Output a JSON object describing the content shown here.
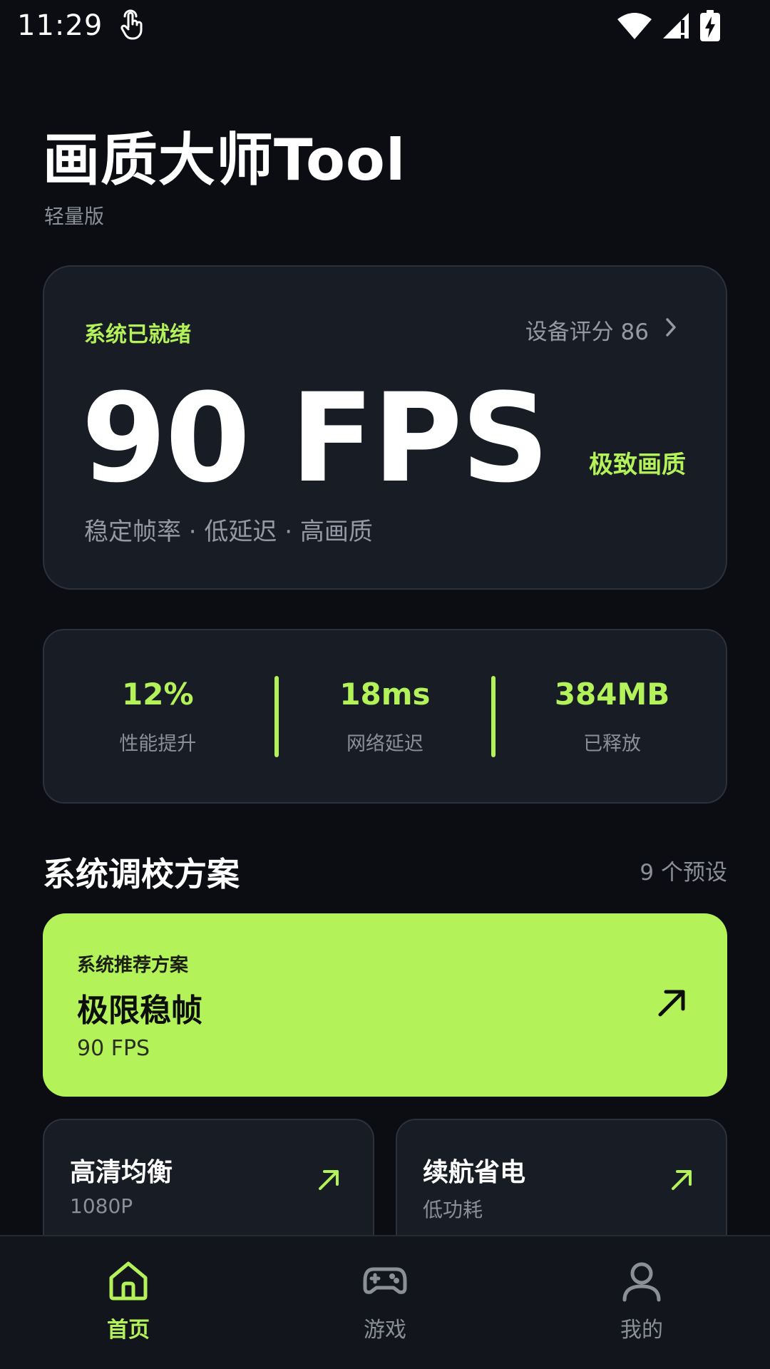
{
  "status_bar": {
    "time": "11:29",
    "icons": [
      "touch-icon",
      "wifi-icon",
      "signal-icon",
      "battery-charging-icon"
    ]
  },
  "header": {
    "title": "画质大师Tool",
    "subtitle": "轻量版"
  },
  "hero": {
    "status": "系统已就绪",
    "score_label": "设备评分 86",
    "fps": "90 FPS",
    "quality": "极致画质",
    "description": "稳定帧率 · 低延迟 · 高画质"
  },
  "stats": [
    {
      "value": "12%",
      "label": "性能提升"
    },
    {
      "value": "18ms",
      "label": "网络延迟"
    },
    {
      "value": "384MB",
      "label": "已释放"
    }
  ],
  "section": {
    "title": "系统调校方案",
    "count": "9 个预设"
  },
  "featured": {
    "tag": "系统推荐方案",
    "name": "极限稳帧",
    "value": "90 FPS"
  },
  "presets": [
    {
      "name": "高清均衡",
      "value": "1080P"
    },
    {
      "name": "续航省电",
      "value": "低功耗"
    }
  ],
  "nav": [
    {
      "label": "首页",
      "icon": "home-icon",
      "active": true
    },
    {
      "label": "游戏",
      "icon": "gamepad-icon",
      "active": false
    },
    {
      "label": "我的",
      "icon": "profile-icon",
      "active": false
    }
  ],
  "colors": {
    "accent": "#b4f25a",
    "background": "#0b0d12",
    "card": "#181c25",
    "muted_text": "#8a8f98"
  }
}
